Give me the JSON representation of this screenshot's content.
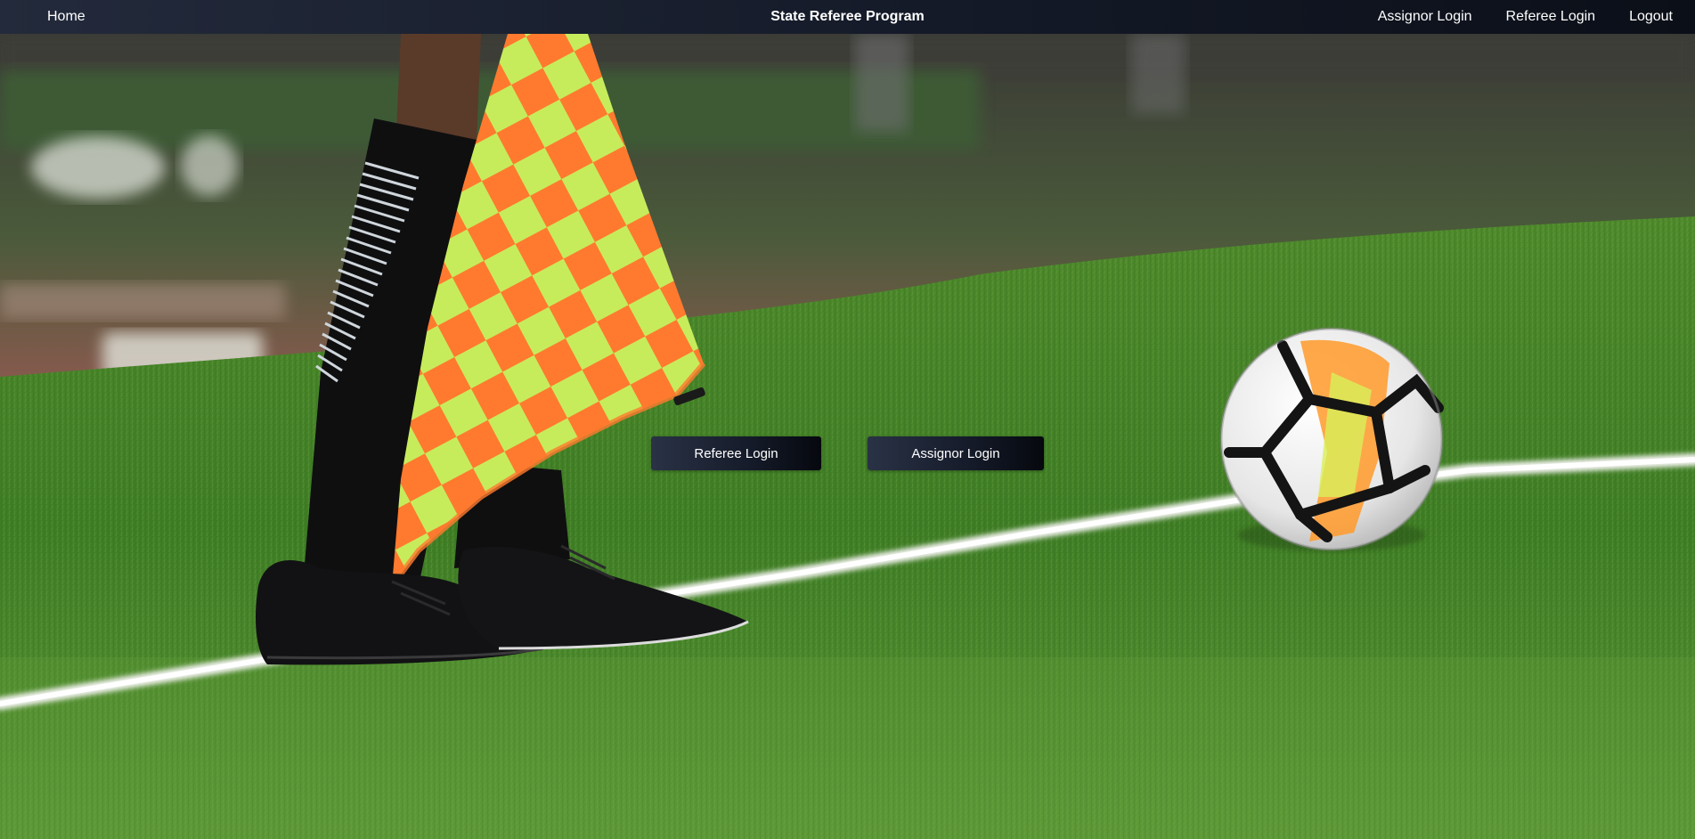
{
  "navbar": {
    "home_label": "Home",
    "title": "State Referee Program",
    "links": [
      "Assignor Login",
      "Referee Login",
      "Logout"
    ]
  },
  "hero": {
    "image_description_icon": "soccer-field-photo",
    "buttons": {
      "referee_login": "Referee Login",
      "assignor_login": "Assignor Login"
    }
  },
  "colors": {
    "nav_start": "#232a3b",
    "nav_end": "#0b0f18",
    "grass": "#3f7d25",
    "track": "#8a4a42",
    "flag_orange": "#ff7a2a",
    "flag_yellow": "#c8f05a"
  }
}
